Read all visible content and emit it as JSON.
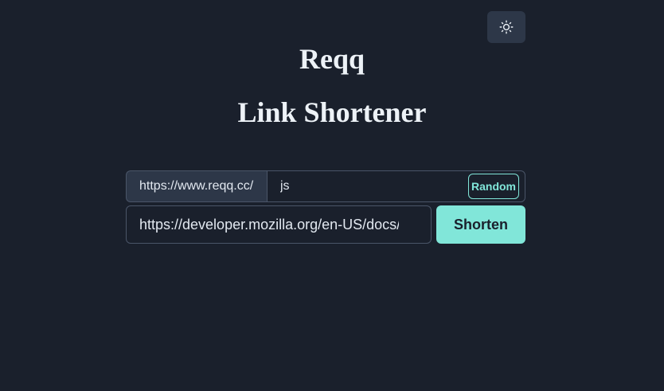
{
  "header": {
    "theme_toggle_icon": "sun-icon"
  },
  "hero": {
    "brand": "Reqq",
    "subtitle": "Link Shortener"
  },
  "form": {
    "prefix": "https://www.reqq.cc/",
    "alias_value": "js",
    "random_label": "Random",
    "url_value": "https://developer.mozilla.org/en-US/docs/",
    "shorten_label": "Shorten"
  },
  "colors": {
    "background": "#1a202c",
    "accent": "#81e6d9",
    "surface": "#2d3748",
    "border": "#4a5568"
  }
}
